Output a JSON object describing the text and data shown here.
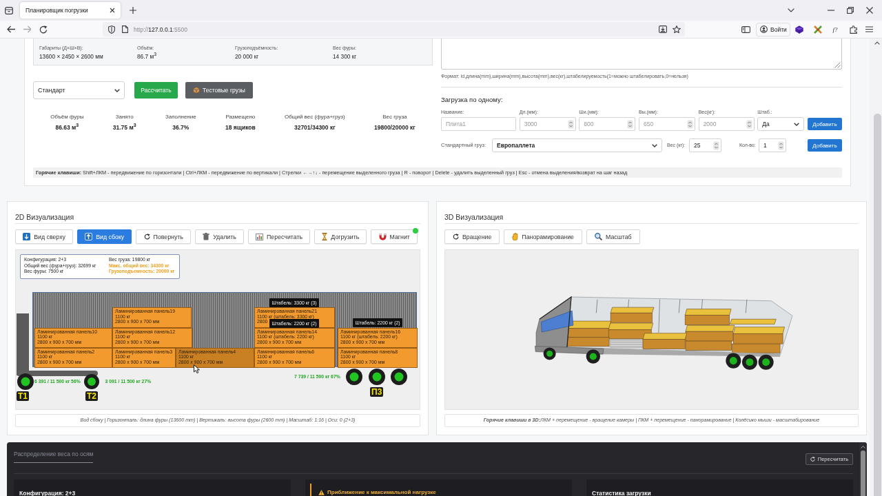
{
  "browser": {
    "tabs": [
      {
        "title": "Планировщик погрузки",
        "selected": true
      }
    ],
    "url": {
      "scheme": "http://",
      "host": "127.0.0.1",
      "port": ":5500"
    },
    "sign_in": "Войти",
    "extension_label": "f?"
  },
  "truck_specs": [
    {
      "label": "Габариты (Д×Ш×В):",
      "value": "13600 × 2450 × 2600 мм"
    },
    {
      "label": "Объём:",
      "value": "86.7 м$^{3}$"
    },
    {
      "label": "Грузоподъёмность:",
      "value": "20 000 кг"
    },
    {
      "label": "Вес фуры:",
      "value": "14 300 кг"
    }
  ],
  "actions": {
    "mode": "Стандарт",
    "calculate": "Рассчитать",
    "test_cargo": "Тестовые грузы"
  },
  "stats": [
    {
      "label": "Объём фуры",
      "value": "86.63 м$^{3}$"
    },
    {
      "label": "Занято",
      "value": "31.75 м$^{3}$"
    },
    {
      "label": "Заполнение",
      "value": "36.7%"
    },
    {
      "label": "Размещено",
      "value": "18 ящиков"
    },
    {
      "label": "Общий вес (фура+груз)",
      "value": "32701/34300 кг"
    },
    {
      "label": "Вес груза",
      "value": "19800/20000 кг"
    }
  ],
  "import": {
    "format_hint": "Формат: id,длина(mm),ширина(mm),высота(mm),вес(кг),штабелируемость(1=можно штабелировать,0=нельзя)"
  },
  "single_load": {
    "title": "Загрузка по одному:",
    "fields": [
      {
        "kind": "text",
        "label": "Название:",
        "placeholder": "Плита1"
      },
      {
        "kind": "number",
        "label": "Дл.(мм):",
        "placeholder": "3000"
      },
      {
        "kind": "number",
        "label": "Ши.(мм):",
        "placeholder": "800"
      },
      {
        "kind": "number",
        "label": "Вы.(мм):",
        "placeholder": "650"
      },
      {
        "kind": "number",
        "label": "Вес(кг):",
        "placeholder": "2000"
      },
      {
        "kind": "select",
        "label": "Штаб.:",
        "value": "Да"
      }
    ],
    "add_button": "Добавить"
  },
  "standard_cargo": {
    "label": "Стандартный груз:",
    "type": "Европаллета",
    "weight_label": "Вес (кг):",
    "weight": "25",
    "count_label": "Кол-во:",
    "count": "1",
    "add_button": "Добавить"
  },
  "hotkeys": "**Горячие клавиши:** Shift+ЛКМ - передвижение по горизонтали | Ctrl+ЛКМ - передвижение по вертикали | Стрелки ←→↑↓ - перемещение выделенного груза | R - поворот | Delete - удалить выделенный груз | Esc - отмена выделения/возврат на шаг назад",
  "view_2d": {
    "title": "2D Визуализация",
    "tools": [
      {
        "label": "Вид сверху",
        "selected": false
      },
      {
        "label": "Вид сбоку",
        "selected": true
      },
      {
        "label": "Повернуть",
        "selected": false
      },
      {
        "label": "Удалить",
        "selected": false
      },
      {
        "label": "Пересчитать",
        "selected": false
      },
      {
        "label": "Догрузить",
        "selected": false
      },
      {
        "label": "Магнит",
        "selected": false
      }
    ],
    "magnet_on": true,
    "info": [
      {
        "text": "Конфигурация: 2+3",
        "warn": false
      },
      {
        "text": "Общий вес (фура+груз): 32699 кг",
        "warn": false
      },
      {
        "text": "Вес фуры: 7500 кг",
        "warn": false
      },
      {
        "text": "Вес груза: 19800 кг",
        "warn": false
      },
      {
        "text": "Макс. общий вес: 34300 кг",
        "warn": true
      },
      {
        "text": "Грузоподъемность: 20000 кг",
        "warn": true
      }
    ],
    "cargo": [
      {
        "name": "Ламинированная панель19",
        "weight": "1100 кг",
        "size": "2800 x 900 x 700 мм",
        "selected": false
      },
      {
        "name": "Ламинированная панель21",
        "weight": "1100 кг (штабель: 3300 кг)",
        "size": "2800",
        "selected": false
      },
      {
        "name": "Ламинированная панель10",
        "weight": "1100 кг",
        "size": "2800 x 900 x 700 мм",
        "selected": false
      },
      {
        "name": "Ламинированная панель12",
        "weight": "1100 кг",
        "size": "2800 x 900 x 700 мм",
        "selected": false
      },
      {
        "name": "Ламинированная панель14",
        "weight": "1100 кг (штабель: 2200 кг)",
        "size": "2800 x 900 x 700 мм",
        "selected": false
      },
      {
        "name": "Ламинированная панель16",
        "weight": "1100 кг (штабель: 2200 кг)",
        "size": "2800 x 900 x 700 мм",
        "selected": false
      },
      {
        "name": "Ламинированная панель2",
        "weight": "1100 кг",
        "size": "2800 x 900 x 700 мм",
        "selected": false
      },
      {
        "name": "Ламинированная панель3",
        "weight": "1100 кг",
        "size": "2800 x 900 x 700 мм",
        "selected": false
      },
      {
        "name": "Ламинированная панель4",
        "weight": "1100 кг",
        "size": "2800 x 900 x 700 мм",
        "selected": true
      },
      {
        "name": "Ламинированная панель6",
        "weight": "1100 кг",
        "size": "2800 x 900 x 700 мм",
        "selected": false
      },
      {
        "name": "Ламинированная панель8",
        "weight": "1100 кг",
        "size": "2800 x 900 x 700 мм",
        "selected": false
      }
    ],
    "stack_labels": [
      "Штабель: 3300 кг (3)",
      "Штабель: 2200 кг (2)",
      "Штабель: 2200 кг (2)"
    ],
    "axles": [
      {
        "label": "Т1",
        "load": "6 391 / 11 500 кг 56%"
      },
      {
        "label": "Т2",
        "load": "3 091 / 11 500 кг 27%"
      },
      {
        "label": "П3",
        "load": "7 739 / 11 500 кг 67%"
      }
    ],
    "caption": "Вид сбоку | Горизонталь: длина фуры (13600 mm) | Вертикаль: высота фуры (2600 mm) | Масштаб: 1:16 | Оси: 0 (2+3)"
  },
  "view_3d": {
    "title": "3D Визуализация",
    "tools": [
      "Вращение",
      "Панорамирование",
      "Масштаб"
    ],
    "caption": "**Горячие клавиши в 3D:**ЛКМ + перемещение - вращение камеры | ПКМ + перемещение - панорамирование | Колёсико мыши - масштабирование"
  },
  "weight_panel": {
    "title": "Распределение веса по осям",
    "recalculate": "Пересчитать",
    "cards": [
      {
        "kind": "plain",
        "title": "Конфигурация: 2+3"
      },
      {
        "kind": "warning",
        "title": "Приближение к максимальной нагрузке"
      },
      {
        "kind": "plain",
        "title": "Статистика загрузки"
      }
    ]
  }
}
